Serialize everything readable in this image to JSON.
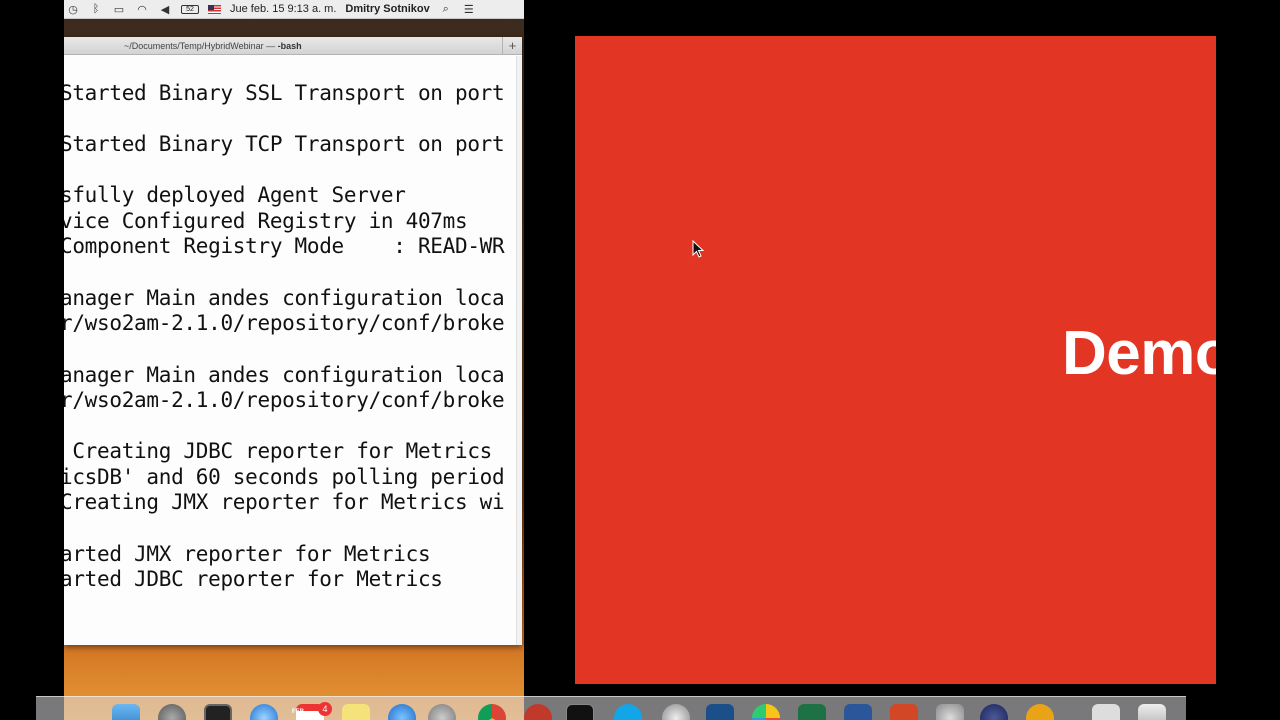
{
  "menubar": {
    "datetime": "Jue feb. 15  9:13 a. m.",
    "user": "Dmitry Sotnikov",
    "battery": "52"
  },
  "terminal": {
    "title_path": "~/Documents/Temp/HybridWebinar — ",
    "title_cmd": "-bash",
    "new_tab": "+",
    "lines": [
      "Started Binary SSL Transport on port",
      "Started Binary TCP Transport on port",
      "sfully deployed Agent Server",
      "vice Configured Registry in 407ms",
      "Component Registry Mode    : READ-WR",
      "anager Main andes configuration loca",
      "r/wso2am-2.1.0/repository/conf/broke",
      "anager Main andes configuration loca",
      "r/wso2am-2.1.0/repository/conf/broke",
      " Creating JDBC reporter for Metrics",
      "icsDB' and 60 seconds polling period",
      "Creating JMX reporter for Metrics wi",
      "arted JMX reporter for Metrics",
      "arted JDBC reporter for Metrics"
    ]
  },
  "slide": {
    "title": "Demo",
    "background": "#e33524"
  },
  "dock": {
    "calendar_badge": "4",
    "calendar_month": "FEB"
  }
}
